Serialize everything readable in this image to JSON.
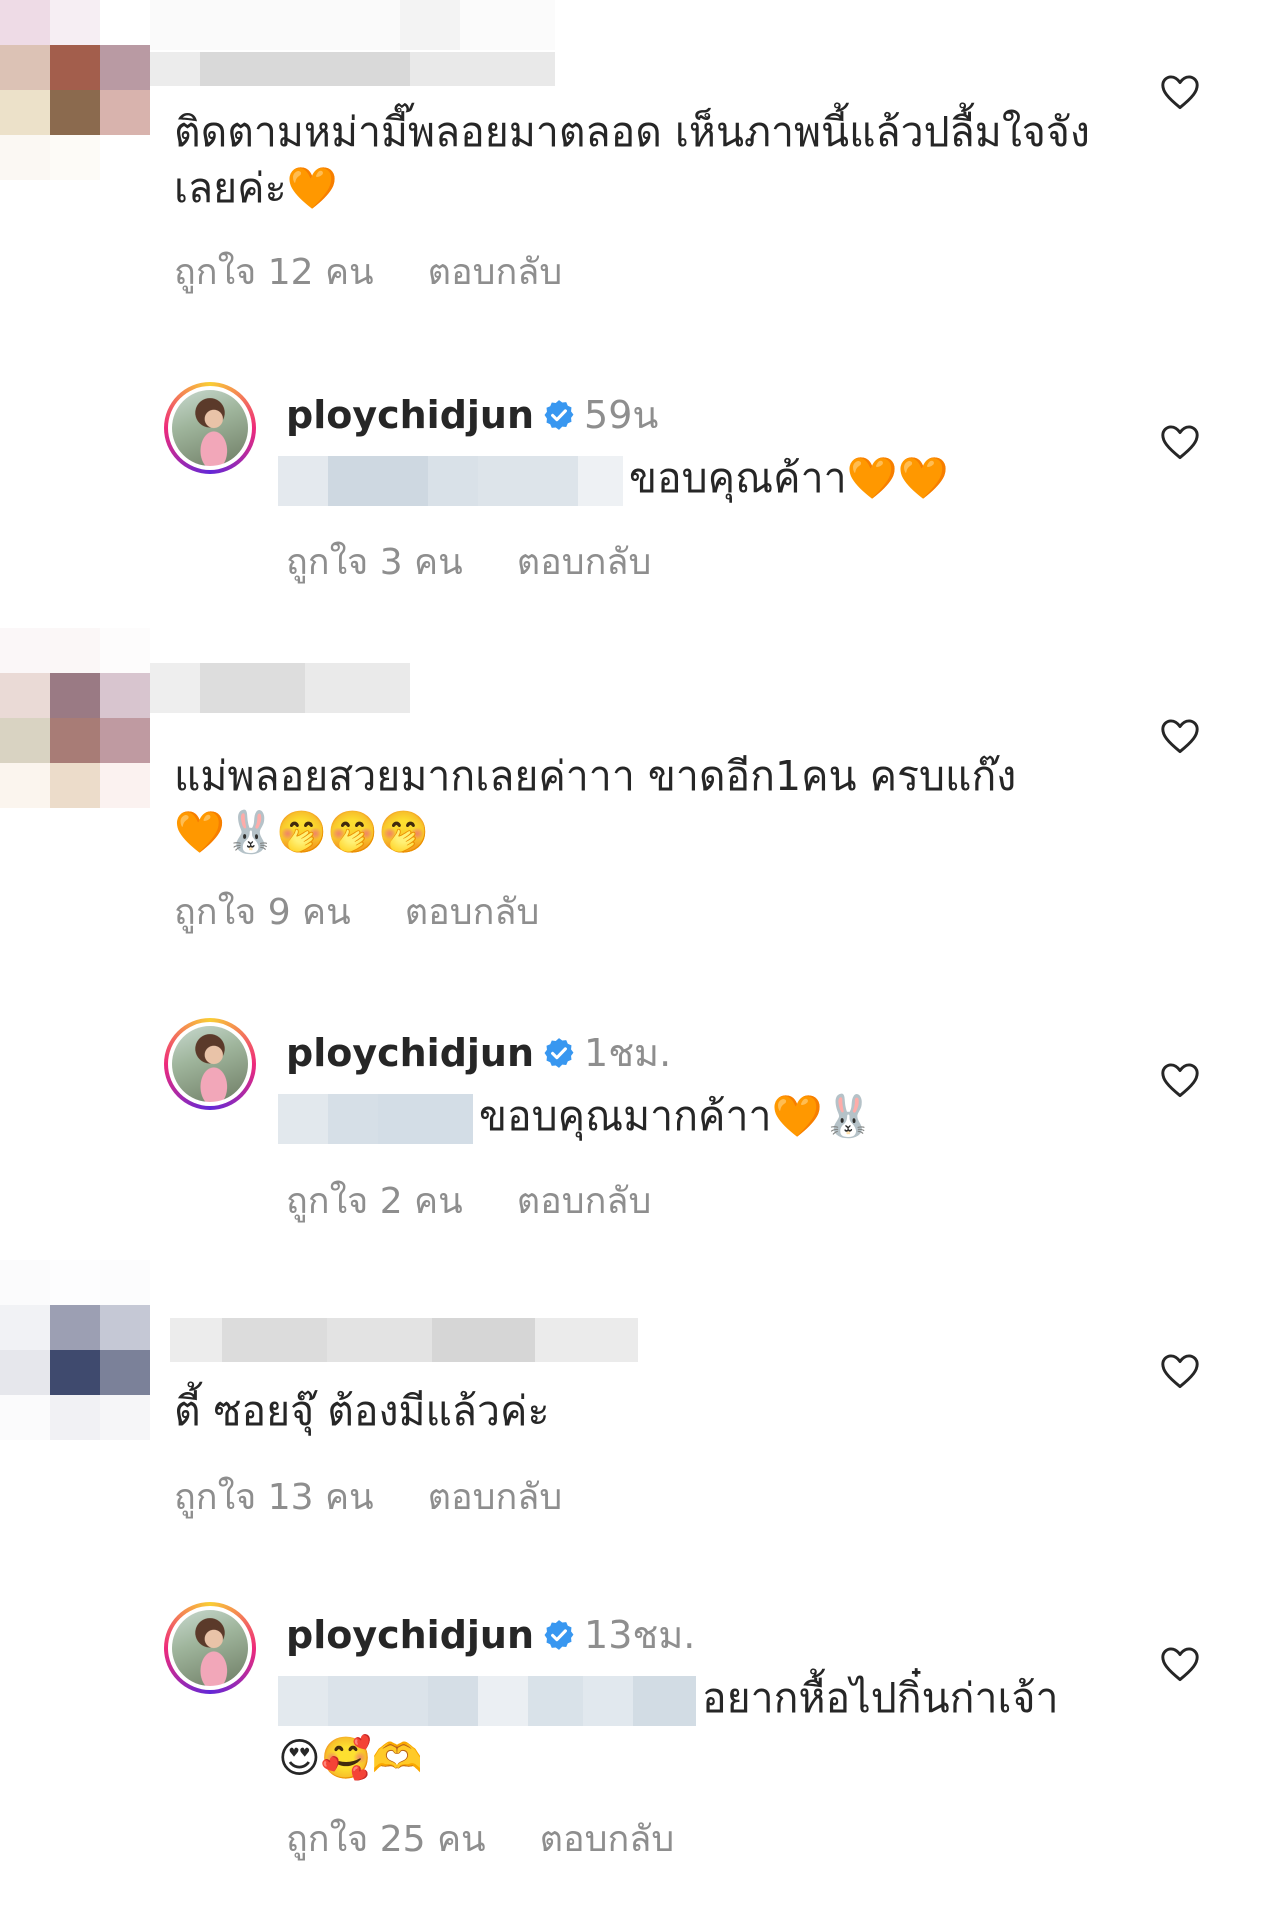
{
  "comments": [
    {
      "text": "ติดตามหม่ามี๊พลอยมาตลอด เห็นภาพนี้แล้วปลื้มใจจังเลยค่ะ🧡",
      "likes": "ถูกใจ 12 คน",
      "reply_label": "ตอบกลับ"
    },
    {
      "text": "แม่พลอยสวยมากเลยค่าาา ขาดอีก1คน ครบแก๊ง\n🧡🐰🤭🤭🤭",
      "likes": "ถูกใจ 9 คน",
      "reply_label": "ตอบกลับ"
    },
    {
      "text": "ตี้ ซอยจุ๊ ต้องมีแล้วค่ะ",
      "likes": "ถูกใจ 13 คน",
      "reply_label": "ตอบกลับ"
    }
  ],
  "replies": [
    {
      "username": "ploychidjun",
      "time": "59น",
      "text": "ขอบคุณค้าา🧡🧡",
      "likes": "ถูกใจ 3 คน",
      "reply_label": "ตอบกลับ"
    },
    {
      "username": "ploychidjun",
      "time": "1ชม.",
      "text": "ขอบคุณมากค้าา🧡🐰",
      "likes": "ถูกใจ 2 คน",
      "reply_label": "ตอบกลับ"
    },
    {
      "username": "ploychidjun",
      "time": "13ชม.",
      "text": "อยากหื้อไปกิ๋นก่าเจ้า",
      "text2": "😍🥰🫶",
      "likes": "ถูกใจ 25 คน",
      "reply_label": "ตอบกลับ"
    }
  ],
  "colors": {
    "text": "#262626",
    "secondary": "#8e8e8e",
    "verified": "#3897f0"
  },
  "icons": {
    "like": "heart-outline-icon",
    "verified": "verified-badge-icon"
  }
}
